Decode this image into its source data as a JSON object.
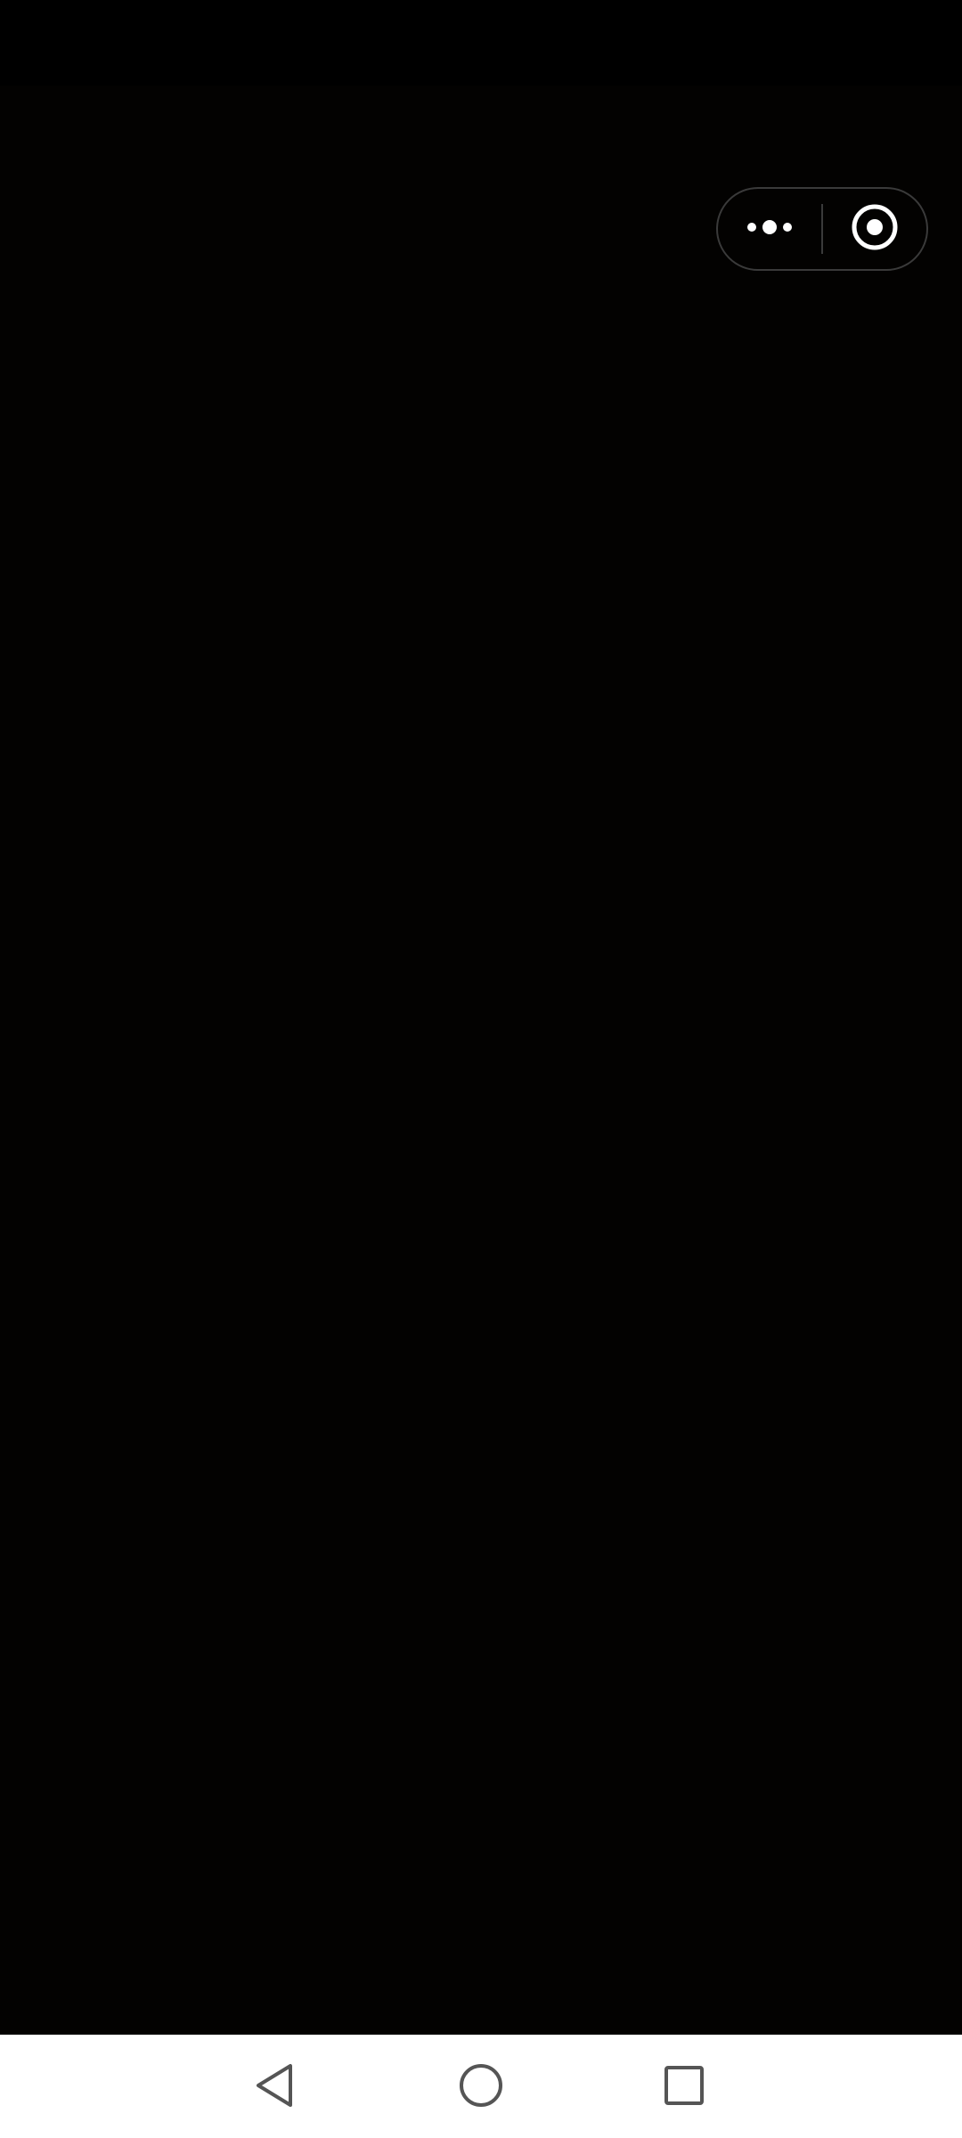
{
  "status_bar": {},
  "mini_program_capsule": {
    "more_icon": "more-dots-icon",
    "close_icon": "target-circle-icon",
    "border_color": "#3a3a3a",
    "icon_color": "#ffffff"
  },
  "navigation_bar": {
    "back_icon": "triangle-back-icon",
    "home_icon": "circle-home-icon",
    "recents_icon": "square-recents-icon",
    "icon_color": "#555555",
    "background": "#ffffff"
  },
  "colors": {
    "content_background": "#030201",
    "status_bar_background": "#000000"
  }
}
